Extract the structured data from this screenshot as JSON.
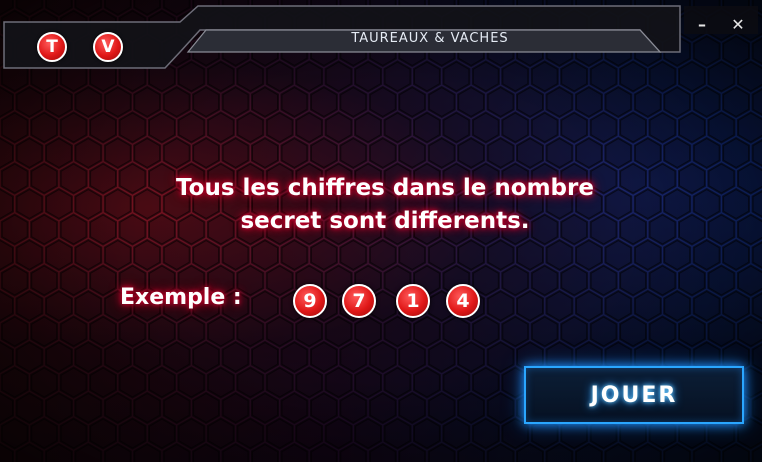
{
  "window": {
    "title": "TAUREAUX & VACHES",
    "minimize_label": "–",
    "close_label": "✕"
  },
  "logo": {
    "badges": [
      "T",
      "V"
    ]
  },
  "main": {
    "message_line1": "Tous les chiffres dans le nombre",
    "message_line2": "secret sont differents.",
    "example_label": "Exemple :",
    "example_digits": [
      "9",
      "7",
      "1",
      "4"
    ],
    "play_label": "JOUER"
  },
  "colors": {
    "badge_red": "#e01818",
    "glow_red": "#c4002a",
    "button_border_blue": "#2aa6ff"
  }
}
